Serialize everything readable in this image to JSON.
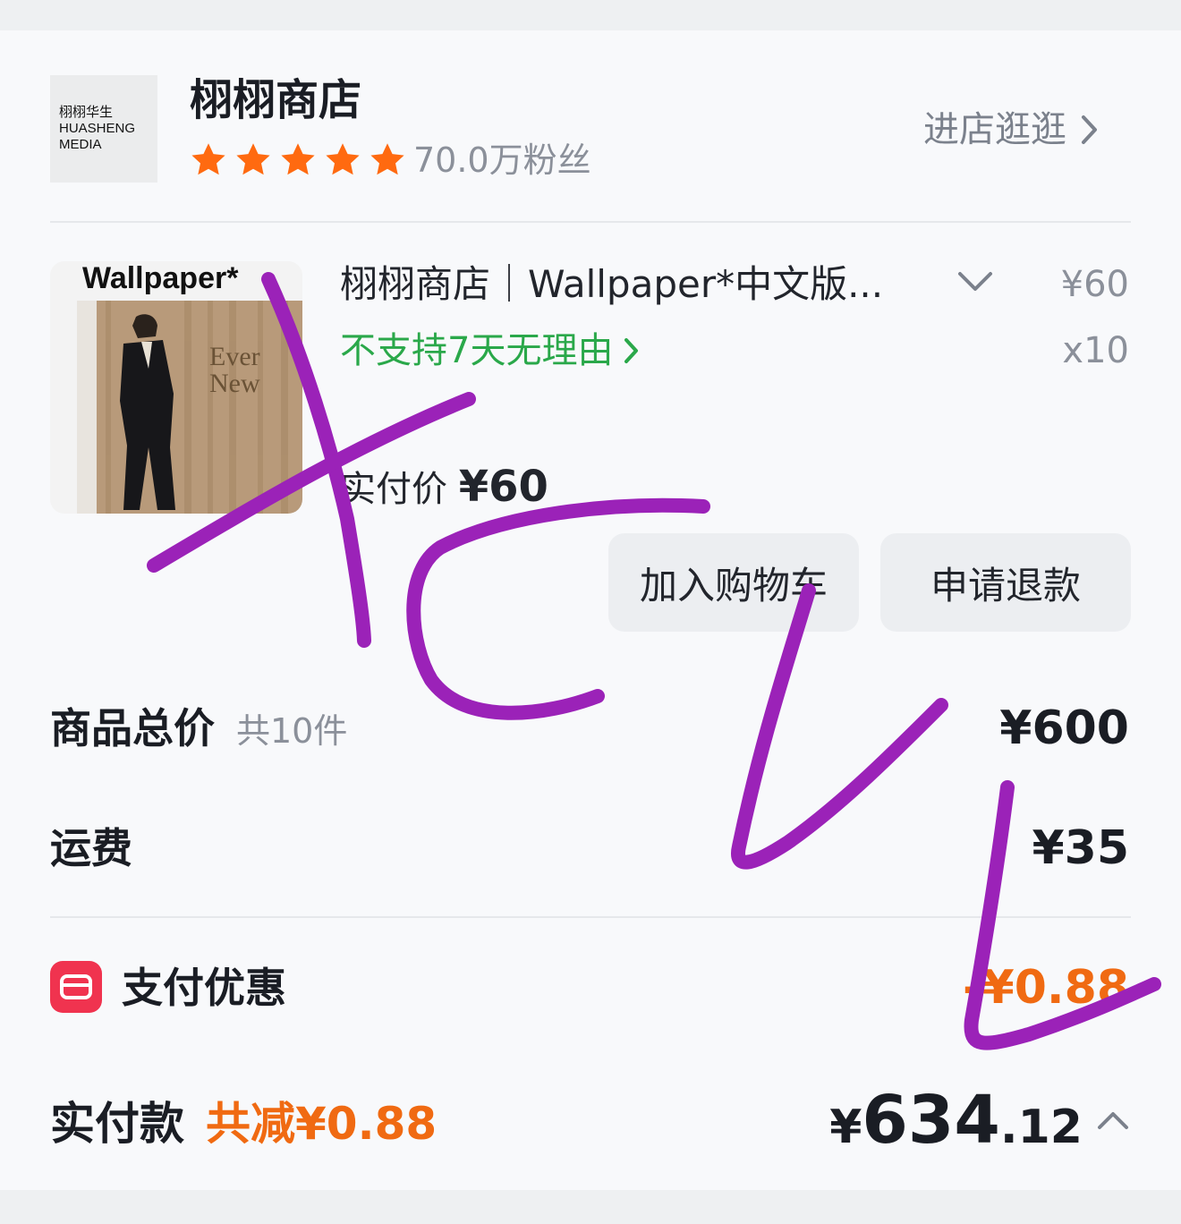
{
  "shop": {
    "logo_text": [
      "栩栩华生",
      "HUASHENG",
      "MEDIA"
    ],
    "name": "栩栩商店",
    "rating_stars": 5,
    "fans": "70.0万粉丝",
    "enter_label": "进店逛逛",
    "star_color": "#ff6a10"
  },
  "product": {
    "cover_title": "Wallpaper*",
    "cover_text_1": "Ever",
    "cover_text_2": "New",
    "title": "栩栩商店｜Wallpaper*中文版...",
    "price": "¥60",
    "quantity": "x10",
    "return_policy": "不支持7天无理由",
    "actual_price_label": "实付价",
    "actual_price_value": "¥60",
    "add_to_cart": "加入购物车",
    "refund": "申请退款"
  },
  "summary": {
    "goods_total_label": "商品总价",
    "goods_count": "共10件",
    "goods_total_value": "¥600",
    "shipping_label": "运费",
    "shipping_value": "¥35",
    "pay_discount_label": "支付优惠",
    "pay_discount_value": "-¥0.88",
    "paid_label": "实付款",
    "saved_text": "共减¥0.88",
    "paid_symbol": "¥",
    "paid_integer": "634",
    "paid_decimal": ".12"
  },
  "colors": {
    "accent_green": "#2aa84a",
    "accent_orange": "#f06a12",
    "coupon_red": "#f0334f",
    "scribble_purple": "#9b22b8"
  }
}
